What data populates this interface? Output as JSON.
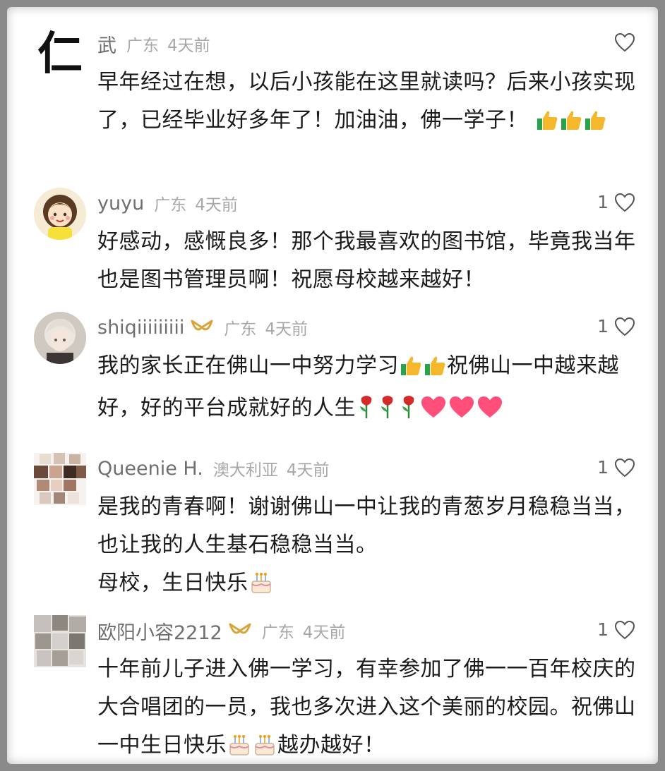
{
  "comments": [
    {
      "username": "武",
      "location": "广东",
      "time": "4天前",
      "likes": "",
      "vip": false,
      "avatar_text": "仁",
      "text_parts": [
        "早年经过在想，以后小孩能在这里就读吗？后来小孩实现了，已经毕业好多年了！加油油，佛一学子！"
      ],
      "emojis": [
        "thumbs-up",
        "thumbs-up",
        "thumbs-up"
      ]
    },
    {
      "username": "yuyu",
      "location": "广东",
      "time": "4天前",
      "likes": "1",
      "vip": false,
      "text_parts": [
        "好感动，感慨良多！那个我最喜欢的图书馆，毕竟我当年也是图书管理员啊！祝愿母校越来越好！"
      ]
    },
    {
      "username": "shiqiiiiiiiii",
      "location": "广东",
      "time": "4天前",
      "likes": "1",
      "vip": true,
      "text_parts": [
        "我的家长正在佛山一中努力学习",
        "祝佛山一中越来越好，好的平台成就好的人生"
      ]
    },
    {
      "username": "Queenie H.",
      "location": "澳大利亚",
      "time": "4天前",
      "likes": "1",
      "vip": false,
      "text_parts": [
        "是我的青春啊！谢谢佛山一中让我的青葱岁月稳稳当当，也让我的人生基石稳稳当当。",
        "母校，生日快乐"
      ]
    },
    {
      "username": "欧阳小容2212",
      "location": "广东",
      "time": "4天前",
      "likes": "1",
      "vip": true,
      "text_parts": [
        "十年前儿子进入佛一学习，有幸参加了佛一一百年校庆的大合唱团的一员，我也多次进入这个美丽的校园。祝佛山一中生日快乐",
        "越办越好！"
      ]
    }
  ],
  "colors": {
    "username": "#6f6f6f",
    "meta": "#a8a8a8",
    "body": "#1b1b1b",
    "vip_gold": "#d9a53a"
  }
}
